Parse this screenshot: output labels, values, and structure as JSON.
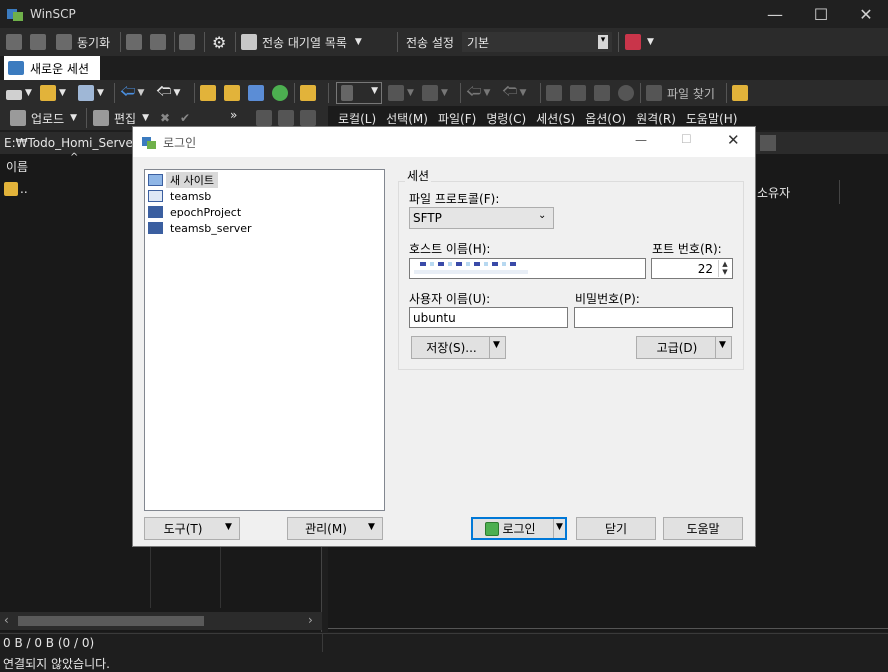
{
  "window": {
    "title": "WinSCP"
  },
  "toolbar1": {
    "sync_label": "동기화",
    "queue_label": "전송 대기열 목록",
    "transfer_settings_label": "전송 설정",
    "transfer_preset": "기본"
  },
  "tabs": {
    "new_session": "새로운 세션"
  },
  "toolbar_left": {
    "upload_label": "업로드",
    "edit_label": "편집",
    "more": "»"
  },
  "toolbar_right": {
    "find_files_label": "파일 찾기"
  },
  "menu": {
    "items": [
      "로컬(L)",
      "선택(M)",
      "파일(F)",
      "명령(C)",
      "세션(S)",
      "옵션(O)",
      "원격(R)",
      "도움말(H)"
    ]
  },
  "left_panel": {
    "path": "E:₩Todo_Homi_Server₩",
    "col_name": "이름",
    "parent_dir": ".."
  },
  "right_panel": {
    "col_owner": "소유자"
  },
  "status": {
    "selection": "0 B / 0 B (0 / 0)",
    "connection": "연결되지 않았습니다."
  },
  "dialog": {
    "title": "로그인",
    "sites": [
      {
        "label": "새 사이트",
        "icon": "new-site-icon"
      },
      {
        "label": "teamsb",
        "icon": "site-folder-icon"
      },
      {
        "label": "epochProject",
        "icon": "monitor-icon"
      },
      {
        "label": "teamsb_server",
        "icon": "monitor-icon"
      }
    ],
    "session_group": "세션",
    "protocol_label": "파일 프로토콜(F):",
    "protocol_value": "SFTP",
    "host_label": "호스트 이름(H):",
    "host_value": "",
    "port_label": "포트 번호(R):",
    "port_value": "22",
    "user_label": "사용자 이름(U):",
    "user_value": "ubuntu",
    "password_label": "비밀번호(P):",
    "password_value": "",
    "save_button": "저장(S)...",
    "advanced_button": "고급(D)",
    "tools_button": "도구(T)",
    "manage_button": "관리(M)",
    "login_button": "로그인",
    "close_button": "닫기",
    "help_button": "도움말"
  }
}
